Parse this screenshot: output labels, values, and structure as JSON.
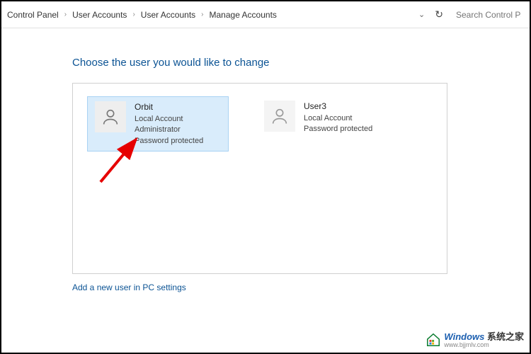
{
  "breadcrumb": {
    "items": [
      "Control Panel",
      "User Accounts",
      "User Accounts",
      "Manage Accounts"
    ]
  },
  "search": {
    "placeholder": "Search Control Panel"
  },
  "page": {
    "title": "Choose the user you would like to change",
    "add_user_link": "Add a new user in PC settings"
  },
  "accounts": [
    {
      "name": "Orbit",
      "type": "Local Account",
      "role": "Administrator",
      "protection": "Password protected",
      "selected": true
    },
    {
      "name": "User3",
      "type": "Local Account",
      "role": "",
      "protection": "Password protected",
      "selected": false
    }
  ],
  "watermark": {
    "brand_en": "Windows",
    "brand_cn": "系统之家",
    "url": "www.bjjmlv.com"
  }
}
